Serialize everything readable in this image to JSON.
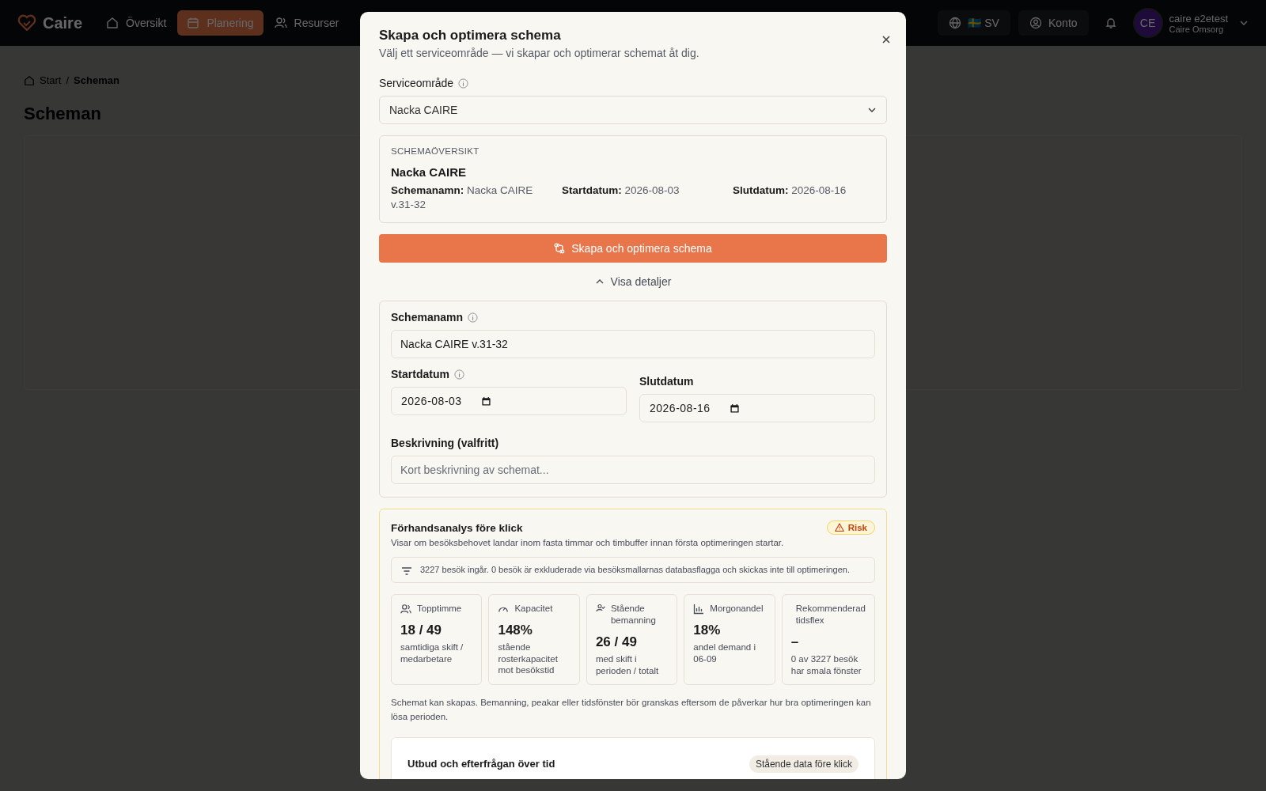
{
  "nav": {
    "logo": "Caire",
    "items": [
      {
        "label": "Översikt",
        "selected": false
      },
      {
        "label": "Planering",
        "selected": true
      },
      {
        "label": "Resurser",
        "selected": false
      }
    ],
    "language": {
      "flag": "🇸🇪",
      "label": "SV"
    },
    "account": {
      "label": "Konto"
    },
    "user": {
      "initials": "CE",
      "name": "caire e2etest",
      "org": "Caire Omsorg"
    }
  },
  "breadcrumb_separator": "/",
  "breadcrumb": [
    {
      "label": "Start",
      "current": false
    },
    {
      "label": "Scheman",
      "current": true
    }
  ],
  "page_title": "Scheman",
  "dialog": {
    "title": "Skapa och optimera schema",
    "subtitle": "Välj ett serviceområde — vi skapar och optimerar schemat åt dig.",
    "service_area": {
      "label": "Serviceområde",
      "info": true,
      "value": "Nacka CAIRE"
    },
    "overview": {
      "heading": "SCHEMAÖVERSIKT",
      "name": "Nacka CAIRE",
      "fields": [
        {
          "label": "Schemanamn:",
          "value": "Nacka CAIRE v.31-32"
        },
        {
          "label": "Startdatum:",
          "value": "2026-08-03"
        },
        {
          "label": "Slutdatum:",
          "value": "2026-08-16"
        }
      ]
    },
    "primary_button": "Skapa och optimera schema",
    "details_toggle": {
      "label": "Visa detaljer",
      "expanded": true
    },
    "details": {
      "name": {
        "label": "Schemanamn",
        "info": true,
        "value": "Nacka CAIRE v.31-32"
      },
      "dates": [
        {
          "label": "Startdatum",
          "info": true,
          "value": "2026-08-03"
        },
        {
          "label": "Slutdatum",
          "info": false,
          "value": "2026-08-16"
        }
      ],
      "description": {
        "label": "Beskrivning (valfritt)",
        "placeholder": "Kort beskrivning av schemat..."
      }
    },
    "analysis": {
      "title": "Förhandsanalys före klick",
      "badge": "Risk",
      "description": "Visar om besöksbehovet landar inom fasta timmar och timbuffer innan första optimeringen startar.",
      "note": "3227 besök ingår. 0 besök är exkluderade via besöksmallarnas databasflagga och skickas inte till optimeringen.",
      "metrics": [
        {
          "label": "Topptimme",
          "value": "18 / 49",
          "caption": "samtidiga skift / medarbetare"
        },
        {
          "label": "Kapacitet",
          "value": "148%",
          "caption": "stående rosterkapacitet mot besökstid"
        },
        {
          "label": "Stående bemanning",
          "value": "26 / 49",
          "caption": "med skift i perioden / totalt"
        },
        {
          "label": "Morgonandel",
          "value": "18%",
          "caption": "andel demand i 06-09"
        },
        {
          "label": "Rekommenderad tidsflex",
          "value": "–",
          "caption": "0 av 3227 besök har smala fönster"
        }
      ],
      "summary": "Schemat kan skapas. Bemanning, peakar eller tidsfönster bör granskas eftersom de påverkar hur bra optimeringen kan lösa perioden.",
      "chart_card": {
        "title": "Utbud och efterfrågan över tid",
        "tag": "Stående data före klick"
      }
    }
  }
}
